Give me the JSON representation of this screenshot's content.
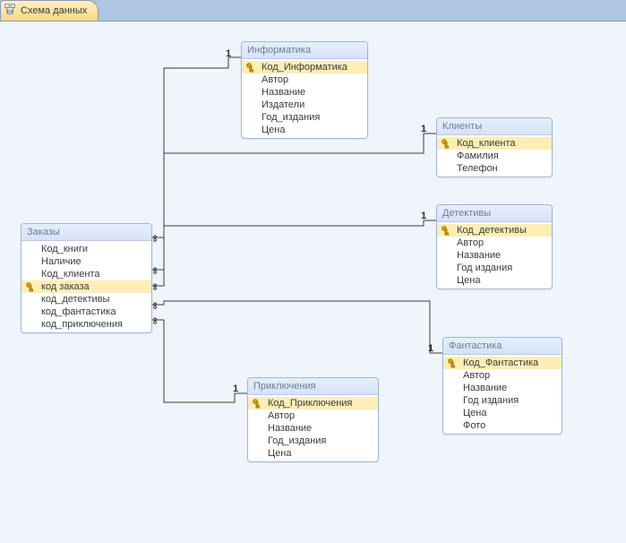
{
  "tab": {
    "title": "Схема данных"
  },
  "entities": {
    "zakazy": {
      "title": "Заказы",
      "fields": [
        {
          "name": "Код_книги",
          "pk": false
        },
        {
          "name": "Наличие",
          "pk": false
        },
        {
          "name": "Код_клиента",
          "pk": false
        },
        {
          "name": "код заказа",
          "pk": true
        },
        {
          "name": "код_детективы",
          "pk": false
        },
        {
          "name": "код_фантастика",
          "pk": false
        },
        {
          "name": "код_приключения",
          "pk": false
        }
      ]
    },
    "informatika": {
      "title": "Информатика",
      "fields": [
        {
          "name": "Код_Информатика",
          "pk": true
        },
        {
          "name": "Автор",
          "pk": false
        },
        {
          "name": "Название",
          "pk": false
        },
        {
          "name": "Издатели",
          "pk": false
        },
        {
          "name": "Год_издания",
          "pk": false
        },
        {
          "name": "Цена",
          "pk": false
        }
      ]
    },
    "klienty": {
      "title": "Клиенты",
      "fields": [
        {
          "name": "Код_клиента",
          "pk": true
        },
        {
          "name": "Фамилия",
          "pk": false
        },
        {
          "name": "Телефон",
          "pk": false
        }
      ]
    },
    "detektivy": {
      "title": "Детективы",
      "fields": [
        {
          "name": "Код_детективы",
          "pk": true
        },
        {
          "name": "Автор",
          "pk": false
        },
        {
          "name": "Название",
          "pk": false
        },
        {
          "name": "Год издания",
          "pk": false
        },
        {
          "name": "Цена",
          "pk": false
        }
      ]
    },
    "fantastika": {
      "title": "Фантастика",
      "fields": [
        {
          "name": "Код_Фантастика",
          "pk": true
        },
        {
          "name": "Автор",
          "pk": false
        },
        {
          "name": "Название",
          "pk": false
        },
        {
          "name": "Год издания",
          "pk": false
        },
        {
          "name": "Цена",
          "pk": false
        },
        {
          "name": "Фото",
          "pk": false
        }
      ]
    },
    "priklyucheniya": {
      "title": "Приключения",
      "fields": [
        {
          "name": "Код_Приключения",
          "pk": true
        },
        {
          "name": "Автор",
          "pk": false
        },
        {
          "name": "Название",
          "pk": false
        },
        {
          "name": "Год_издания",
          "pk": false
        },
        {
          "name": "Цена",
          "pk": false
        }
      ]
    }
  },
  "relationships": [
    {
      "from": "zakazy",
      "from_field": "Код_книги",
      "to": "informatika",
      "to_field": "Код_Информатика",
      "from_card": "∞",
      "to_card": "1"
    },
    {
      "from": "zakazy",
      "from_field": "Код_клиента",
      "to": "klienty",
      "to_field": "Код_клиента",
      "from_card": "∞",
      "to_card": "1"
    },
    {
      "from": "zakazy",
      "from_field": "код_детективы",
      "to": "detektivy",
      "to_field": "Код_детективы",
      "from_card": "∞",
      "to_card": "1"
    },
    {
      "from": "zakazy",
      "from_field": "код_фантастика",
      "to": "fantastika",
      "to_field": "Код_Фантастика",
      "from_card": "∞",
      "to_card": "1"
    },
    {
      "from": "zakazy",
      "from_field": "код_приключения",
      "to": "priklyucheniya",
      "to_field": "Код_Приключения",
      "from_card": "∞",
      "to_card": "1"
    }
  ],
  "cardinality_symbols": {
    "one": "1",
    "many": "∞"
  }
}
